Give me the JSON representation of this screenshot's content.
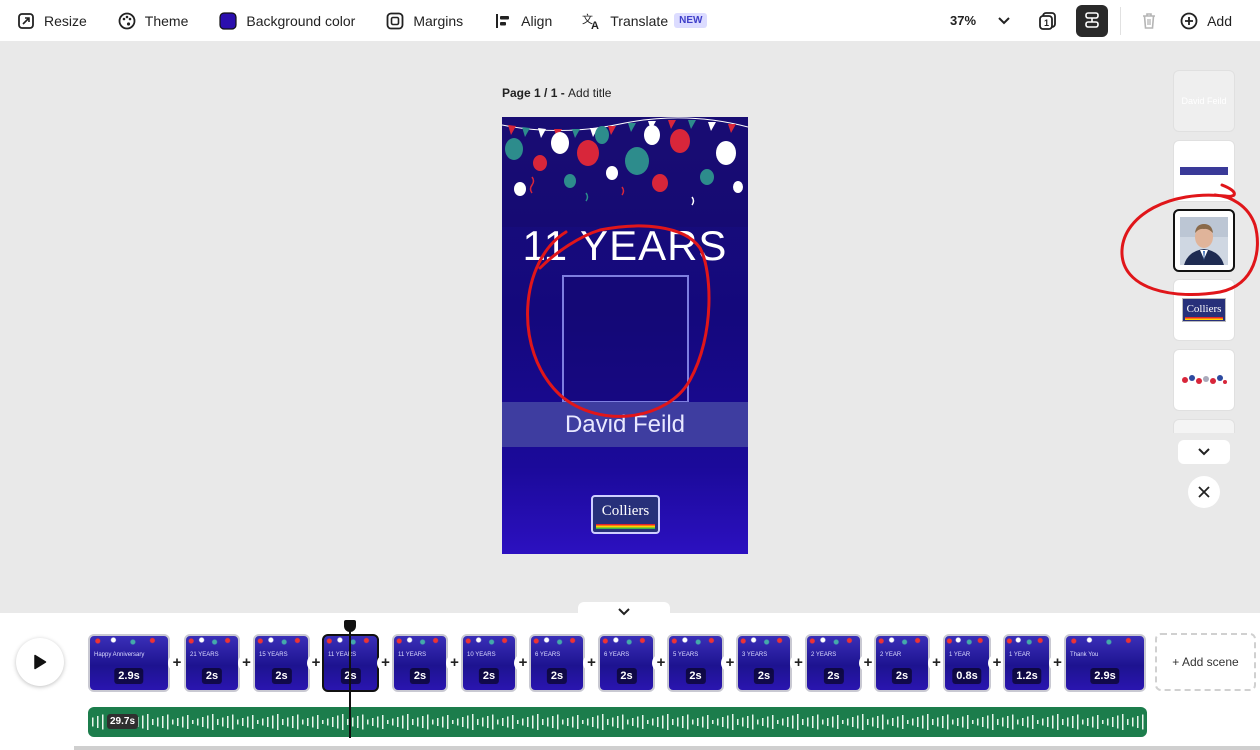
{
  "toolbar": {
    "resize": "Resize",
    "theme": "Theme",
    "background_color": "Background color",
    "margins": "Margins",
    "align": "Align",
    "translate": "Translate",
    "new_badge": "NEW",
    "zoom": "37%",
    "add": "Add"
  },
  "colors": {
    "background_swatch": "#2b0fae",
    "annotation_red": "#e0161a",
    "audio_track": "#1c7d4c"
  },
  "canvas": {
    "page_label": "Page 1 / 1",
    "page_label_sep": " - ",
    "add_title": "Add title",
    "years_text": "11 YEARS",
    "name_text": "David Feild",
    "logo_text": "Colliers"
  },
  "layers": {
    "item1_text": "David Feild",
    "item4_text": "Colliers"
  },
  "timeline": {
    "scenes": [
      {
        "duration": "2.9s",
        "label": "Happy Anniversary"
      },
      {
        "duration": "2s",
        "label": "21 YEARS"
      },
      {
        "duration": "2s",
        "label": "15 YEARS"
      },
      {
        "duration": "2s",
        "label": "11 YEARS"
      },
      {
        "duration": "2s",
        "label": "11 YEARS"
      },
      {
        "duration": "2s",
        "label": "10 YEARS"
      },
      {
        "duration": "2s",
        "label": "6 YEARS"
      },
      {
        "duration": "2s",
        "label": "6 YEARS"
      },
      {
        "duration": "2s",
        "label": "5 YEARS"
      },
      {
        "duration": "2s",
        "label": "3 YEARS"
      },
      {
        "duration": "2s",
        "label": "2 YEARS"
      },
      {
        "duration": "2s",
        "label": "2 YEAR"
      },
      {
        "duration": "0.8s",
        "label": "1 YEAR"
      },
      {
        "duration": "1.2s",
        "label": "1 YEAR"
      },
      {
        "duration": "2.9s",
        "label": "Thank You"
      }
    ],
    "add_scene": "+ Add scene",
    "audio_duration": "29.7s"
  }
}
